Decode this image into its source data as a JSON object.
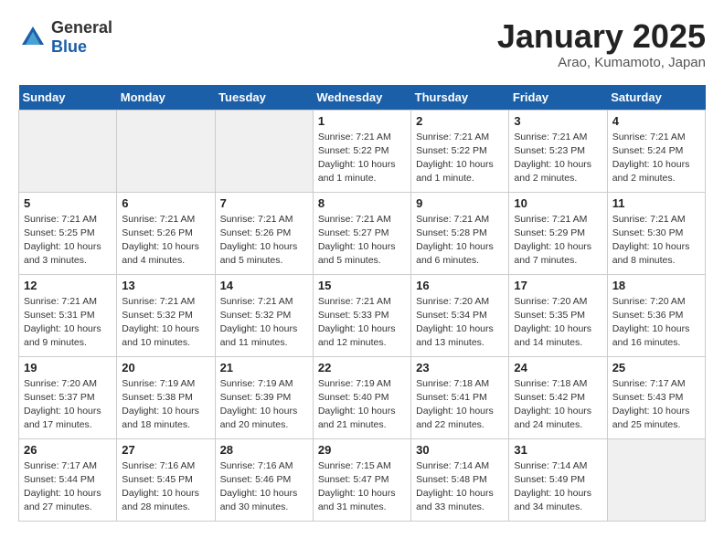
{
  "header": {
    "logo_general": "General",
    "logo_blue": "Blue",
    "title": "January 2025",
    "location": "Arao, Kumamoto, Japan"
  },
  "weekdays": [
    "Sunday",
    "Monday",
    "Tuesday",
    "Wednesday",
    "Thursday",
    "Friday",
    "Saturday"
  ],
  "weeks": [
    [
      {
        "day": "",
        "info": ""
      },
      {
        "day": "",
        "info": ""
      },
      {
        "day": "",
        "info": ""
      },
      {
        "day": "1",
        "info": "Sunrise: 7:21 AM\nSunset: 5:22 PM\nDaylight: 10 hours\nand 1 minute."
      },
      {
        "day": "2",
        "info": "Sunrise: 7:21 AM\nSunset: 5:22 PM\nDaylight: 10 hours\nand 1 minute."
      },
      {
        "day": "3",
        "info": "Sunrise: 7:21 AM\nSunset: 5:23 PM\nDaylight: 10 hours\nand 2 minutes."
      },
      {
        "day": "4",
        "info": "Sunrise: 7:21 AM\nSunset: 5:24 PM\nDaylight: 10 hours\nand 2 minutes."
      }
    ],
    [
      {
        "day": "5",
        "info": "Sunrise: 7:21 AM\nSunset: 5:25 PM\nDaylight: 10 hours\nand 3 minutes."
      },
      {
        "day": "6",
        "info": "Sunrise: 7:21 AM\nSunset: 5:26 PM\nDaylight: 10 hours\nand 4 minutes."
      },
      {
        "day": "7",
        "info": "Sunrise: 7:21 AM\nSunset: 5:26 PM\nDaylight: 10 hours\nand 5 minutes."
      },
      {
        "day": "8",
        "info": "Sunrise: 7:21 AM\nSunset: 5:27 PM\nDaylight: 10 hours\nand 5 minutes."
      },
      {
        "day": "9",
        "info": "Sunrise: 7:21 AM\nSunset: 5:28 PM\nDaylight: 10 hours\nand 6 minutes."
      },
      {
        "day": "10",
        "info": "Sunrise: 7:21 AM\nSunset: 5:29 PM\nDaylight: 10 hours\nand 7 minutes."
      },
      {
        "day": "11",
        "info": "Sunrise: 7:21 AM\nSunset: 5:30 PM\nDaylight: 10 hours\nand 8 minutes."
      }
    ],
    [
      {
        "day": "12",
        "info": "Sunrise: 7:21 AM\nSunset: 5:31 PM\nDaylight: 10 hours\nand 9 minutes."
      },
      {
        "day": "13",
        "info": "Sunrise: 7:21 AM\nSunset: 5:32 PM\nDaylight: 10 hours\nand 10 minutes."
      },
      {
        "day": "14",
        "info": "Sunrise: 7:21 AM\nSunset: 5:32 PM\nDaylight: 10 hours\nand 11 minutes."
      },
      {
        "day": "15",
        "info": "Sunrise: 7:21 AM\nSunset: 5:33 PM\nDaylight: 10 hours\nand 12 minutes."
      },
      {
        "day": "16",
        "info": "Sunrise: 7:20 AM\nSunset: 5:34 PM\nDaylight: 10 hours\nand 13 minutes."
      },
      {
        "day": "17",
        "info": "Sunrise: 7:20 AM\nSunset: 5:35 PM\nDaylight: 10 hours\nand 14 minutes."
      },
      {
        "day": "18",
        "info": "Sunrise: 7:20 AM\nSunset: 5:36 PM\nDaylight: 10 hours\nand 16 minutes."
      }
    ],
    [
      {
        "day": "19",
        "info": "Sunrise: 7:20 AM\nSunset: 5:37 PM\nDaylight: 10 hours\nand 17 minutes."
      },
      {
        "day": "20",
        "info": "Sunrise: 7:19 AM\nSunset: 5:38 PM\nDaylight: 10 hours\nand 18 minutes."
      },
      {
        "day": "21",
        "info": "Sunrise: 7:19 AM\nSunset: 5:39 PM\nDaylight: 10 hours\nand 20 minutes."
      },
      {
        "day": "22",
        "info": "Sunrise: 7:19 AM\nSunset: 5:40 PM\nDaylight: 10 hours\nand 21 minutes."
      },
      {
        "day": "23",
        "info": "Sunrise: 7:18 AM\nSunset: 5:41 PM\nDaylight: 10 hours\nand 22 minutes."
      },
      {
        "day": "24",
        "info": "Sunrise: 7:18 AM\nSunset: 5:42 PM\nDaylight: 10 hours\nand 24 minutes."
      },
      {
        "day": "25",
        "info": "Sunrise: 7:17 AM\nSunset: 5:43 PM\nDaylight: 10 hours\nand 25 minutes."
      }
    ],
    [
      {
        "day": "26",
        "info": "Sunrise: 7:17 AM\nSunset: 5:44 PM\nDaylight: 10 hours\nand 27 minutes."
      },
      {
        "day": "27",
        "info": "Sunrise: 7:16 AM\nSunset: 5:45 PM\nDaylight: 10 hours\nand 28 minutes."
      },
      {
        "day": "28",
        "info": "Sunrise: 7:16 AM\nSunset: 5:46 PM\nDaylight: 10 hours\nand 30 minutes."
      },
      {
        "day": "29",
        "info": "Sunrise: 7:15 AM\nSunset: 5:47 PM\nDaylight: 10 hours\nand 31 minutes."
      },
      {
        "day": "30",
        "info": "Sunrise: 7:14 AM\nSunset: 5:48 PM\nDaylight: 10 hours\nand 33 minutes."
      },
      {
        "day": "31",
        "info": "Sunrise: 7:14 AM\nSunset: 5:49 PM\nDaylight: 10 hours\nand 34 minutes."
      },
      {
        "day": "",
        "info": ""
      }
    ]
  ]
}
